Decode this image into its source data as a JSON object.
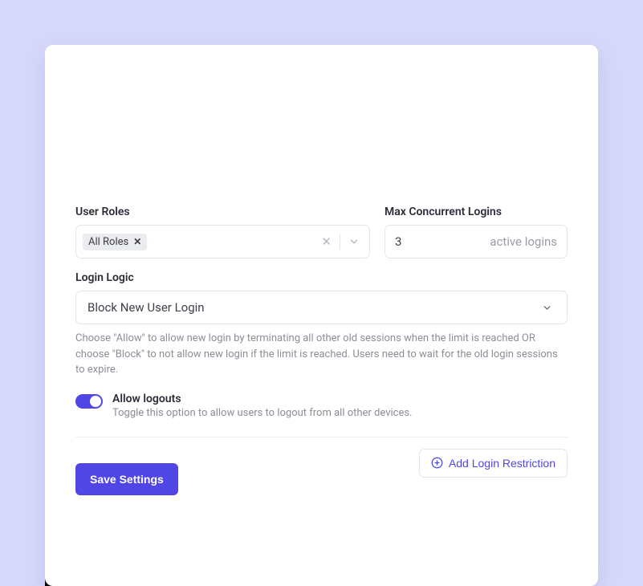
{
  "labels": {
    "user_roles": "User Roles",
    "max_logins": "Max Concurrent Logins",
    "login_logic": "Login Logic"
  },
  "roles": {
    "tag": "All Roles"
  },
  "max": {
    "value": "3",
    "suffix": "active logins"
  },
  "logic": {
    "selected": "Block New User Login",
    "helper": "Choose \"Allow\" to allow new login by terminating all other old sessions when the limit is reached OR choose \"Block\" to not allow new login if the limit is reached. Users need to wait for the old login sessions to expire."
  },
  "toggle": {
    "title": "Allow logouts",
    "desc": "Toggle this option to allow users to logout from all other devices."
  },
  "buttons": {
    "add": "Add Login Restriction",
    "save": "Save Settings"
  }
}
